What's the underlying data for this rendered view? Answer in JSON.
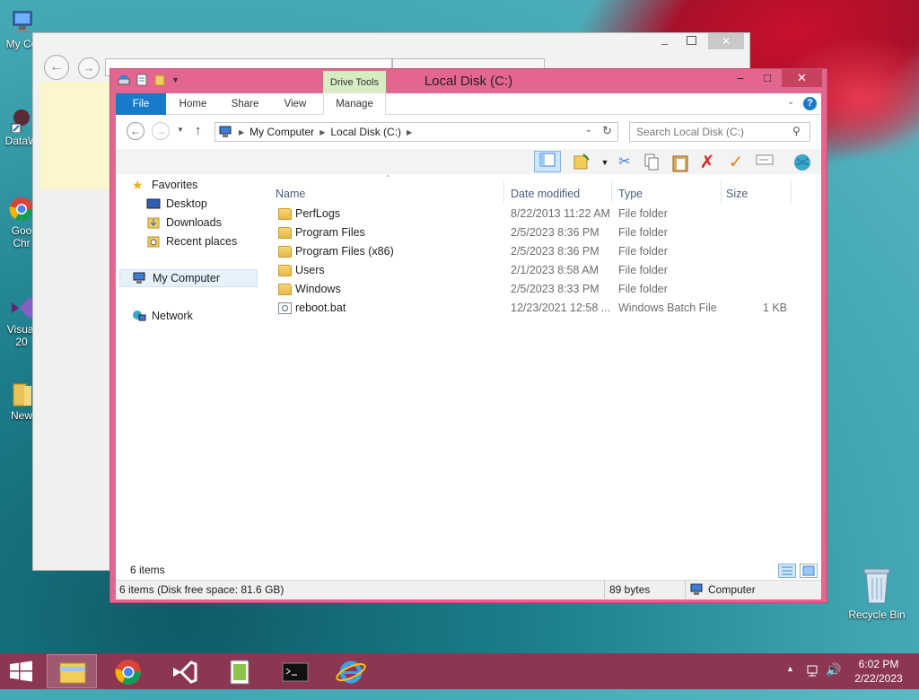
{
  "desktop": {
    "icons": [
      {
        "label": "My Co",
        "icon": "computer-icon"
      },
      {
        "label": "DataW",
        "icon": "shortcut-icon"
      },
      {
        "label": "Goo",
        "label2": "Chr",
        "icon": "chrome-icon"
      },
      {
        "label": "Visual",
        "label2": "20",
        "icon": "visual-studio-icon"
      },
      {
        "label": "New",
        "icon": "folder-icon"
      }
    ],
    "recycle_bin": "Recycle Bin"
  },
  "explorer": {
    "title": "Local Disk (C:)",
    "contextual_tab": "Drive Tools",
    "ribbon_tabs": [
      "File",
      "Home",
      "Share",
      "View",
      "Manage"
    ],
    "address": {
      "root_icon": "computer-icon",
      "segments": [
        "My Computer",
        "Local Disk (C:)"
      ]
    },
    "search_placeholder": "Search Local Disk (C:)",
    "nav_pane": {
      "favorites": "Favorites",
      "favorites_items": [
        "Desktop",
        "Downloads",
        "Recent places"
      ],
      "computer": "My Computer",
      "network": "Network"
    },
    "columns": [
      "Name",
      "Date modified",
      "Type",
      "Size"
    ],
    "files": [
      {
        "name": "PerfLogs",
        "date": "8/22/2013 11:22 AM",
        "type": "File folder",
        "size": "",
        "icon": "folder-icon"
      },
      {
        "name": "Program Files",
        "date": "2/5/2023 8:36 PM",
        "type": "File folder",
        "size": "",
        "icon": "folder-icon"
      },
      {
        "name": "Program Files (x86)",
        "date": "2/5/2023 8:36 PM",
        "type": "File folder",
        "size": "",
        "icon": "folder-icon"
      },
      {
        "name": "Users",
        "date": "2/1/2023 8:58 AM",
        "type": "File folder",
        "size": "",
        "icon": "folder-icon"
      },
      {
        "name": "Windows",
        "date": "2/5/2023 8:33 PM",
        "type": "File folder",
        "size": "",
        "icon": "folder-icon"
      },
      {
        "name": "reboot.bat",
        "date": "12/23/2021 12:58 ...",
        "type": "Windows Batch File",
        "size": "1 KB",
        "icon": "batch-file-icon"
      }
    ],
    "item_count": "6 items",
    "status": {
      "left": "6 items (Disk free space: 81.6 GB)",
      "middle": "89 bytes",
      "right": "Computer"
    }
  },
  "taskbar": {
    "apps": [
      "file-explorer-icon",
      "chrome-icon",
      "visual-studio-icon",
      "notepad-plus-plus-icon",
      "cmd-icon",
      "internet-explorer-icon"
    ],
    "clock_time": "6:02 PM",
    "clock_date": "2/22/2023"
  },
  "colors": {
    "window_frame": "#e3668e",
    "ribbon_file_tab": "#1979ca",
    "taskbar": "#8c3651"
  }
}
